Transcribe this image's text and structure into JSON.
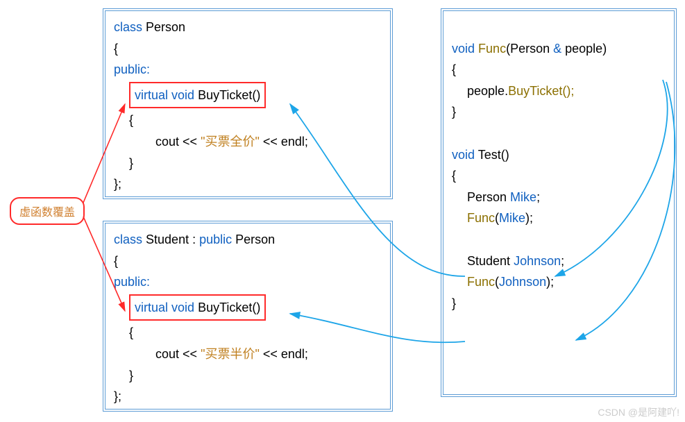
{
  "annotation": {
    "label": "虚函数覆盖"
  },
  "person": {
    "decl_class": "class",
    "decl_name": "Person",
    "open": "{",
    "public": "public:",
    "virtual": "virtual void",
    "method": "BuyTicket()",
    "body_open": "{",
    "cout_pre": "cout << ",
    "cout_str": "\"买票全价\"",
    "cout_post": " << endl;",
    "body_close": "}",
    "close": "};"
  },
  "student": {
    "decl_prefix": "class",
    "decl_name": "Student",
    "decl_colon": " : ",
    "decl_public": "public",
    "decl_base": " Person",
    "open": "{",
    "public": "public:",
    "virtual": "virtual void",
    "method": "BuyTicket()",
    "body_open": "{",
    "cout_pre": "cout << ",
    "cout_str": "\"买票半价\"",
    "cout_post": " << endl;",
    "body_close": "}",
    "close": "};"
  },
  "func": {
    "void1": "void",
    "fname": "Func",
    "param_open": "(",
    "param_type": "Person",
    "param_amp": " & ",
    "param_name": "people",
    "param_close": ")",
    "open1": "{",
    "call_obj": "people",
    "call_dot": ".",
    "call_method": "BuyTicket();",
    "close1": "}",
    "void2": "void",
    "tname": "Test()",
    "open2": "{",
    "mike_type": "Person ",
    "mike_name": "Mike",
    "mike_semi": ";",
    "mike_call_fn": "Func",
    "mike_call_open": "(",
    "mike_call_arg": "Mike",
    "mike_call_close": ");",
    "johnson_type": "Student ",
    "johnson_name": "Johnson",
    "johnson_semi": ";",
    "johnson_call_fn": "Func",
    "johnson_call_open": "(",
    "johnson_call_arg": "Johnson",
    "johnson_call_close": ");",
    "close2": "}"
  },
  "watermark": "CSDN @是阿建吖!"
}
